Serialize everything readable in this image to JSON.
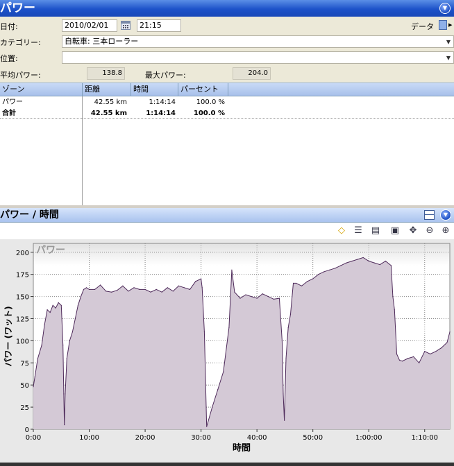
{
  "window": {
    "title": "パワー"
  },
  "form": {
    "date_label": "日付:",
    "date_value": "2010/02/01",
    "time_value": "21:15",
    "data_label": "データ",
    "category_label": "カテゴリー:",
    "category_value": "自転車: 三本ローラー",
    "location_label": "位置:",
    "location_value": "",
    "avg_power_label": "平均パワー:",
    "avg_power_value": "138.8",
    "max_power_label": "最大パワー:",
    "max_power_value": "204.0"
  },
  "table": {
    "columns": [
      "ゾーン",
      "距離",
      "時間",
      "パーセント"
    ],
    "rows": [
      {
        "zone": "パワー",
        "distance": "42.55 km",
        "time": "1:14:14",
        "percent": "100.0 %"
      }
    ],
    "total": {
      "zone": "合計",
      "distance": "42.55 km",
      "time": "1:14:14",
      "percent": "100.0 %"
    }
  },
  "chart_panel": {
    "title": "パワー / 時間"
  },
  "chart_data": {
    "type": "area",
    "watermark": "パワー",
    "xlabel": "時間",
    "ylabel": "パワー (ワット)",
    "xlim": [
      0,
      74.5
    ],
    "ylim": [
      0,
      210
    ],
    "x_ticks": [
      0,
      10,
      20,
      30,
      40,
      50,
      60,
      70
    ],
    "x_tick_labels": [
      "0:00",
      "10:00",
      "20:00",
      "30:00",
      "40:00",
      "50:00",
      "1:00:00",
      "1:10:00"
    ],
    "y_ticks": [
      0,
      25,
      50,
      75,
      100,
      125,
      150,
      175,
      200
    ],
    "y_tick_labels": [
      "0",
      "25",
      "50",
      "75",
      "100",
      "125",
      "150",
      "175",
      "200"
    ],
    "grid": true,
    "colors": {
      "fill": "#d4c9d6",
      "line": "#4e2a5a",
      "bg_top": "#e2e2e2",
      "bg": "#ffffff"
    },
    "series": [
      {
        "x": [
          0,
          0.3,
          0.8,
          1.5,
          2,
          2.5,
          3,
          3.5,
          4,
          4.5,
          5,
          5.3,
          5.45,
          5.55,
          5.7,
          6,
          6.5,
          7,
          7.5,
          8,
          8.5,
          9,
          9.5,
          10,
          11,
          12,
          13,
          14,
          15,
          16,
          17,
          18,
          19,
          20,
          21,
          22,
          23,
          24,
          25,
          26,
          27,
          28,
          29,
          30,
          30.2,
          30.6,
          31,
          32,
          33,
          34,
          35,
          35.5,
          36,
          37,
          38,
          39,
          40,
          41,
          42,
          43,
          44,
          44.5,
          44.7,
          44.9,
          45.2,
          45.6,
          46,
          46.5,
          47,
          48,
          49,
          50,
          51,
          52,
          53,
          54,
          55,
          56,
          57,
          58,
          59,
          60,
          61,
          62,
          63,
          64,
          64.3,
          64.6,
          65,
          65.5,
          66,
          67,
          68,
          69,
          70,
          71,
          72,
          73,
          74,
          74.5
        ],
        "y": [
          48,
          60,
          80,
          95,
          118,
          135,
          132,
          140,
          137,
          143,
          140,
          95,
          40,
          5,
          40,
          80,
          100,
          110,
          125,
          140,
          150,
          158,
          160,
          158,
          158,
          163,
          156,
          155,
          157,
          162,
          156,
          160,
          158,
          158,
          155,
          158,
          155,
          160,
          156,
          162,
          160,
          158,
          167,
          170,
          160,
          110,
          3,
          25,
          45,
          65,
          115,
          180,
          155,
          148,
          152,
          150,
          148,
          153,
          150,
          147,
          148,
          100,
          40,
          10,
          80,
          115,
          130,
          165,
          165,
          162,
          167,
          170,
          175,
          178,
          180,
          182,
          185,
          188,
          190,
          192,
          194,
          190,
          188,
          186,
          190,
          185,
          150,
          135,
          85,
          78,
          77,
          80,
          82,
          75,
          88,
          85,
          88,
          92,
          98,
          110
        ]
      }
    ]
  }
}
